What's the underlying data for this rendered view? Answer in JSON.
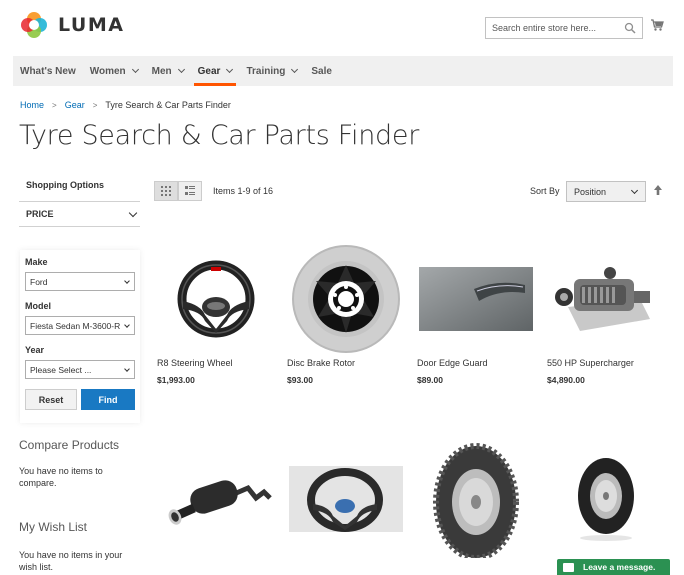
{
  "brand": {
    "name": "LUMA"
  },
  "search": {
    "placeholder": "Search entire store here..."
  },
  "nav": {
    "items": [
      {
        "label": "What's New",
        "dropdown": false
      },
      {
        "label": "Women",
        "dropdown": true
      },
      {
        "label": "Men",
        "dropdown": true
      },
      {
        "label": "Gear",
        "dropdown": true,
        "active": true
      },
      {
        "label": "Training",
        "dropdown": true
      },
      {
        "label": "Sale",
        "dropdown": false
      }
    ]
  },
  "breadcrumb": {
    "home": "Home",
    "gear": "Gear",
    "current": "Tyre Search & Car Parts Finder",
    "separator": ">"
  },
  "page_title": "Tyre Search & Car Parts Finder",
  "sidebar": {
    "shopping_options": "Shopping Options",
    "price_filter": "PRICE",
    "finder": {
      "make_label": "Make",
      "make_value": "Ford",
      "model_label": "Model",
      "model_value": "Fiesta Sedan M-3600-R",
      "year_label": "Year",
      "year_value": "Please Select ...",
      "reset_label": "Reset",
      "find_label": "Find"
    },
    "compare_title": "Compare Products",
    "compare_text": "You have no items to compare.",
    "wishlist_title": "My Wish List",
    "wishlist_text": "You have no items in your wish list."
  },
  "toolbar": {
    "items_count": "Items 1-9 of 16",
    "sort_label": "Sort By",
    "sort_value": "Position"
  },
  "products": [
    {
      "name": "R8 Steering Wheel",
      "price": "$1,993.00"
    },
    {
      "name": "Disc Brake Rotor",
      "price": "$93.00"
    },
    {
      "name": "Door Edge Guard",
      "price": "$89.00"
    },
    {
      "name": "550 HP Supercharger",
      "price": "$4,890.00"
    }
  ],
  "chat": {
    "label": "Leave a message."
  },
  "colors": {
    "accent": "#ff5501",
    "link": "#006bb4",
    "primary_button": "#1979c3",
    "chat": "#2b9152"
  }
}
